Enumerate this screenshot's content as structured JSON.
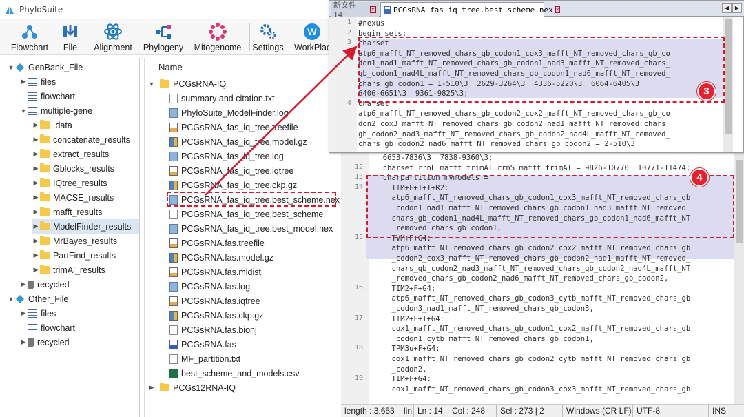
{
  "app": {
    "title": "PhyloSuite"
  },
  "toolbar": [
    {
      "label": "Flowchart",
      "icon": "flowchart-icon"
    },
    {
      "label": "File",
      "icon": "file-import-icon"
    },
    {
      "label": "Alignment",
      "icon": "atom-icon"
    },
    {
      "label": "Phylogeny",
      "icon": "tree-icon"
    },
    {
      "label": "Mitogenome",
      "icon": "circle-dots-icon"
    },
    {
      "label": "Settings",
      "icon": "gear-icon"
    },
    {
      "label": "WorkPlac",
      "icon": "workplace-icon"
    }
  ],
  "left_tree": {
    "genbank": "GenBank_File",
    "genbank_children": [
      "files",
      "flowchart",
      "multiple-gene"
    ],
    "multigene_children": [
      ".data",
      "concatenate_results",
      "extract_results",
      "Gblocks_results",
      "IQtree_results",
      "MACSE_results",
      "mafft_results",
      "ModelFinder_results",
      "MrBayes_results",
      "PartFind_results",
      "trimAl_results"
    ],
    "recycled": "recycled",
    "other": "Other_File",
    "other_children": [
      "files",
      "flowchart",
      "recycled"
    ]
  },
  "file_list": {
    "header": "Name",
    "folder": "PCGsRNA-IQ",
    "files": [
      {
        "name": "summary and citation.txt",
        "type": "txt"
      },
      {
        "name": "PhyloSuite_ModelFinder.log",
        "type": "log"
      },
      {
        "name": "PCGsRNA_fas_iq_tree.treefile",
        "type": "edit"
      },
      {
        "name": "PCGsRNA_fas_iq_tree.model.gz",
        "type": "gz"
      },
      {
        "name": "PCGsRNA_fas_iq_tree.log",
        "type": "log"
      },
      {
        "name": "PCGsRNA_fas_iq_tree.iqtree",
        "type": "edit"
      },
      {
        "name": "PCGsRNA_fas_iq_tree.ckp.gz",
        "type": "gz"
      },
      {
        "name": "PCGsRNA_fas_iq_tree.best_scheme.nex",
        "type": "log"
      },
      {
        "name": "PCGsRNA_fas_iq_tree.best_scheme",
        "type": "txt"
      },
      {
        "name": "PCGsRNA_fas_iq_tree.best_model.nex",
        "type": "log"
      },
      {
        "name": "PCGsRNA.fas.treefile",
        "type": "edit"
      },
      {
        "name": "PCGsRNA.fas.model.gz",
        "type": "gz"
      },
      {
        "name": "PCGsRNA.fas.mldist",
        "type": "edit"
      },
      {
        "name": "PCGsRNA.fas.log",
        "type": "log"
      },
      {
        "name": "PCGsRNA.fas.iqtree",
        "type": "edit"
      },
      {
        "name": "PCGsRNA.fas.ckp.gz",
        "type": "gz"
      },
      {
        "name": "PCGsRNA.fas.bionj",
        "type": "txt"
      },
      {
        "name": "PCGsRNA.fas",
        "type": "chart"
      },
      {
        "name": "MF_partition.txt",
        "type": "txt"
      },
      {
        "name": "best_scheme_and_models.csv",
        "type": "xl"
      }
    ],
    "next_folder": "PCGs12RNA-IQ"
  },
  "editor": {
    "tabs": [
      "新文件 14",
      "PCGsRNA_fas_iq_tree.best_scheme.nex"
    ],
    "popup_lines": [
      {
        "n": "1",
        "text": "#nexus"
      },
      {
        "n": "2",
        "text": "begin sets;"
      },
      {
        "n": "3",
        "text": "charset"
      },
      {
        "n": "",
        "text": "atp6_mafft_NT_removed_chars_gb_codon1_cox3_mafft_NT_removed_chars_gb_co"
      },
      {
        "n": "",
        "text": "don1_nad1_mafft_NT_removed_chars_gb_codon1_nad3_mafft_NT_removed_chars_"
      },
      {
        "n": "",
        "text": "gb_codon1_nad4L_mafft_NT_removed_chars_gb_codon1_nad6_mafft_NT_removed_"
      },
      {
        "n": "",
        "text": "chars_gb_codon1 = 1-510\\3  2629-3264\\3  4336-5220\\3  6064-6405\\3"
      },
      {
        "n": "",
        "text": "6406-6651\\3  9361-9825\\3;"
      },
      {
        "n": "4",
        "text": "charset"
      },
      {
        "n": "",
        "text": "atp6_mafft_NT_removed_chars_gb_codon2_cox2_mafft_NT_removed_chars_gb_co"
      },
      {
        "n": "",
        "text": "don2_cox3_mafft_NT_removed_chars_gb_codon2_nad1_mafft_NT_removed_chars_"
      },
      {
        "n": "",
        "text": "gb_codon2_nad3_mafft_NT_removed_chars_gb_codon2_nad4L_mafft_NT_removed_"
      },
      {
        "n": "",
        "text": "chars_gb_codon2_nad6_mafft_NT_removed_chars_gb_codon2 = 2-510\\3"
      }
    ],
    "main_lines": [
      {
        "n": "",
        "text": "  6653-7836\\3  7838-9360\\3;"
      },
      {
        "n": "12",
        "text": "  charset rrnL_mafft_trimAl rrnS_mafft_trimAl = 9826-10770  10771-11474;"
      },
      {
        "n": "13",
        "text": "  charpartition mymodels ="
      },
      {
        "n": "14",
        "text": "    TIM+F+I+I+R2:"
      },
      {
        "n": "",
        "text": "    atp6_mafft_NT_removed_chars_gb_codon1_cox3_mafft_NT_removed_chars_gb"
      },
      {
        "n": "",
        "text": "    _codon1_nad1_mafft_NT_removed_chars_gb_codon1_nad3_mafft_NT_removed_"
      },
      {
        "n": "",
        "text": "    chars_gb_codon1_nad4L_mafft_NT_removed_chars_gb_codon1_nad6_mafft_NT"
      },
      {
        "n": "",
        "text": "    _removed_chars_gb_codon1,"
      },
      {
        "n": "15",
        "text": "    TVM+F+G4:"
      },
      {
        "n": "",
        "text": "    atp6_mafft_NT_removed_chars_gb_codon2_cox2_mafft_NT_removed_chars_gb"
      },
      {
        "n": "",
        "text": "    _codon2_cox3_mafft_NT_removed_chars_gb_codon2_nad1_mafft_NT_removed_"
      },
      {
        "n": "",
        "text": "    chars_gb_codon2_nad3_mafft_NT_removed_chars_gb_codon2_nad4L_mafft_NT"
      },
      {
        "n": "",
        "text": "    _removed_chars_gb_codon2_nad6_mafft_NT_removed_chars_gb_codon2,"
      },
      {
        "n": "16",
        "text": "    TIM2+F+G4:"
      },
      {
        "n": "",
        "text": "    atp6_mafft_NT_removed_chars_gb_codon3_cytb_mafft_NT_removed_chars_gb"
      },
      {
        "n": "",
        "text": "    _codon3_nad1_mafft_NT_removed_chars_gb_codon3,"
      },
      {
        "n": "17",
        "text": "    TIM2+F+I+G4:"
      },
      {
        "n": "",
        "text": "    cox1_mafft_NT_removed_chars_gb_codon1_cox2_mafft_NT_removed_chars_gb"
      },
      {
        "n": "",
        "text": "    _codon1_cytb_mafft_NT_removed_chars_gb_codon1,"
      },
      {
        "n": "18",
        "text": "    TPM3u+F+G4:"
      },
      {
        "n": "",
        "text": "    cox1_mafft_NT_removed_chars_gb_codon2_cytb_mafft_NT_removed_chars_gb"
      },
      {
        "n": "",
        "text": "    _codon2,"
      },
      {
        "n": "19",
        "text": "    TIM+F+G4:"
      },
      {
        "n": "",
        "text": "    cox1_mafft_NT_removed_chars_gb_codon3_cox3_mafft_NT_removed_chars_gb"
      }
    ],
    "badges": [
      "3",
      "4"
    ]
  },
  "status": {
    "length": "length : 3,653",
    "lines": "lin",
    "ln": "Ln : 14",
    "col": "Col : 248",
    "sel": "Sel : 273 | 2",
    "eol": "Windows (CR LF)",
    "enc": "UTF-8",
    "ins": "INS"
  },
  "colors": {
    "highlight": "#d8182c",
    "selection": "#dcdcf0",
    "folder": "#f7c948"
  }
}
